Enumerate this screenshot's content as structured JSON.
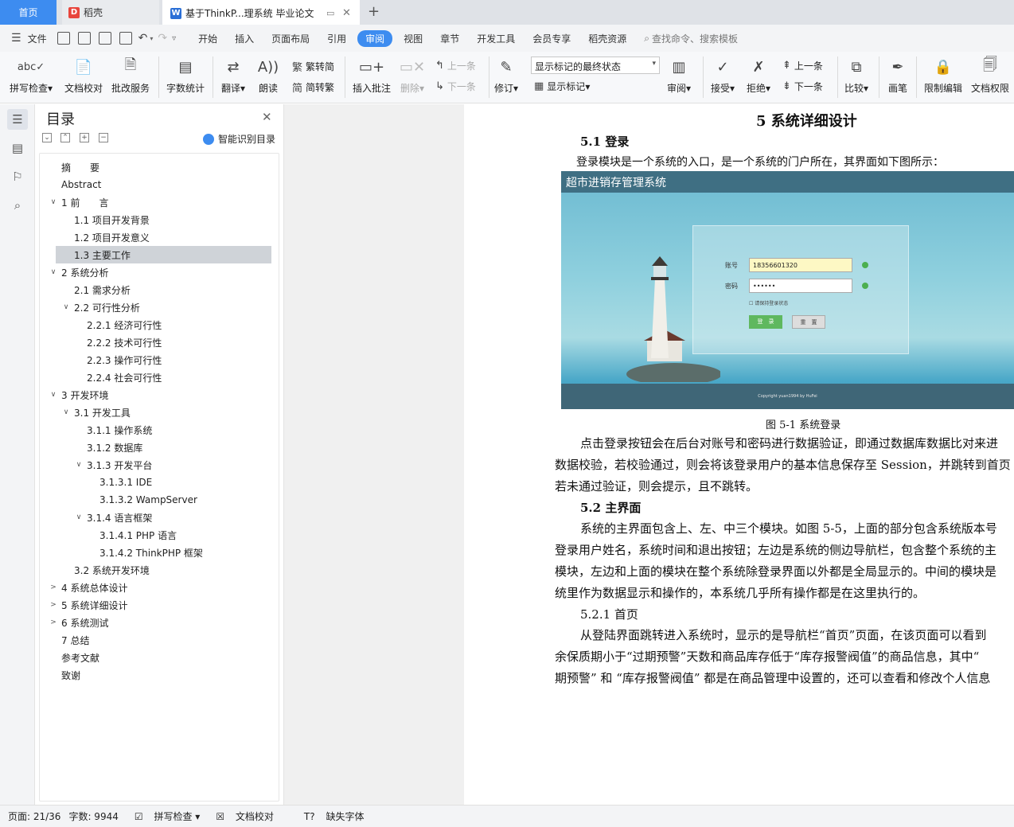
{
  "tabs": {
    "home": "首页",
    "daoke": "稻壳",
    "doc": "基于ThinkP...理系统 毕业论文"
  },
  "menu": {
    "file": "文件",
    "items": [
      "开始",
      "插入",
      "页面布局",
      "引用",
      "审阅",
      "视图",
      "章节",
      "开发工具",
      "会员专享",
      "稻壳资源"
    ],
    "active": "审阅",
    "search_placeholder": "查找命令、搜索模板"
  },
  "ribbon": {
    "spell_check": "拼写检查",
    "doc_proof": "文档校对",
    "batch_service": "批改服务",
    "word_count": "字数统计",
    "translate": "翻译",
    "read_aloud": "朗读",
    "trad_conv": "繁转简",
    "simp_conv": "简转繁",
    "insert_comment": "插入批注",
    "delete": "删除",
    "prev": "上一条",
    "next": "下一条",
    "track": "修订",
    "markup_state": "显示标记的最终状态",
    "show_markup": "显示标记",
    "review": "审阅",
    "accept": "接受",
    "reject": "拒绝",
    "prev2": "上一条",
    "next2": "下一条",
    "compare": "比较",
    "ink": "画笔",
    "restrict_edit": "限制编辑",
    "doc_rights": "文档权限"
  },
  "toc": {
    "title": "目录",
    "smart": "智能识别目录",
    "items": [
      {
        "label": "摘　　要",
        "level": 0,
        "tw": ""
      },
      {
        "label": "Abstract",
        "level": 0,
        "tw": ""
      },
      {
        "label": "1 前　　言",
        "level": 0,
        "tw": "v"
      },
      {
        "label": "1.1  项目开发背景",
        "level": 1,
        "tw": ""
      },
      {
        "label": "1.2  项目开发意义",
        "level": 1,
        "tw": ""
      },
      {
        "label": "1.3  主要工作",
        "level": 1,
        "tw": "",
        "selected": true
      },
      {
        "label": "2  系统分析",
        "level": 0,
        "tw": "v"
      },
      {
        "label": "2.1  需求分析",
        "level": 1,
        "tw": ""
      },
      {
        "label": "2.2  可行性分析",
        "level": 1,
        "tw": "v"
      },
      {
        "label": "2.2.1  经济可行性",
        "level": 2,
        "tw": ""
      },
      {
        "label": "2.2.2  技术可行性",
        "level": 2,
        "tw": ""
      },
      {
        "label": "2.2.3  操作可行性",
        "level": 2,
        "tw": ""
      },
      {
        "label": "2.2.4  社会可行性",
        "level": 2,
        "tw": ""
      },
      {
        "label": "3  开发环境",
        "level": 0,
        "tw": "v"
      },
      {
        "label": "3.1  开发工具",
        "level": 1,
        "tw": "v"
      },
      {
        "label": "3.1.1  操作系统",
        "level": 2,
        "tw": ""
      },
      {
        "label": "3.1.2  数据库",
        "level": 2,
        "tw": ""
      },
      {
        "label": "3.1.3  开发平台",
        "level": 2,
        "tw": "v"
      },
      {
        "label": "3.1.3.1 IDE",
        "level": 3,
        "tw": ""
      },
      {
        "label": "3.1.3.2 WampServer",
        "level": 3,
        "tw": ""
      },
      {
        "label": "3.1.4  语言框架",
        "level": 2,
        "tw": "v"
      },
      {
        "label": "3.1.4.1 PHP 语言",
        "level": 3,
        "tw": ""
      },
      {
        "label": "3.1.4.2 ThinkPHP 框架",
        "level": 3,
        "tw": ""
      },
      {
        "label": "3.2  系统开发环境",
        "level": 1,
        "tw": ""
      },
      {
        "label": "4  系统总体设计",
        "level": 0,
        "tw": ">"
      },
      {
        "label": "5  系统详细设计",
        "level": 0,
        "tw": ">"
      },
      {
        "label": "6  系统测试",
        "level": 0,
        "tw": ">"
      },
      {
        "label": "7  总结",
        "level": 0,
        "tw": ""
      },
      {
        "label": "参考文献",
        "level": 0,
        "tw": ""
      },
      {
        "label": "致谢",
        "level": 0,
        "tw": ""
      }
    ]
  },
  "doc": {
    "chapter": "5  系统详细设计",
    "s51": "5.1  登录",
    "p1": "登录模块是一个系统的入口，是一个系统的门户所在，其界面如下图所示：",
    "fig_title_bar": "超市进销存管理系统",
    "fig_account_label": "账号",
    "fig_account_value": "18356601320",
    "fig_pwd_label": "密码",
    "fig_pwd_value": "••••••",
    "fig_remember": "请保持登录状态",
    "fig_login_btn": "登　录",
    "fig_reset_btn": "重　置",
    "fig_footer": "Copyright yuan1994 by HuFei",
    "caption": "图 5-1  系统登录",
    "p2a": "点击登录按钮会在后台对账号和密码进行数据验证，即通过数据库数据比对来进",
    "p2b": "数据校验，若校验通过，则会将该登录用户的基本信息保存至 Session，并跳转到首页",
    "p2c": "若未通过验证，则会提示，且不跳转。",
    "s52": "5.2  主界面",
    "p3a": "系统的主界面包含上、左、中三个模块。如图 5-5，上面的部分包含系统版本号",
    "p3b": "登录用户姓名，系统时间和退出按钮；左边是系统的侧边导航栏，包含整个系统的主",
    "p3c": "模块，左边和上面的模块在整个系统除登录界面以外都是全局显示的。中间的模块是",
    "p3d": "统里作为数据显示和操作的，本系统几乎所有操作都是在这里执行的。",
    "s521": "5.2.1  首页",
    "p4a": "从登陆界面跳转进入系统时，显示的是导航栏“首页”页面，在该页面可以看到",
    "p4b": "余保质期小于“过期预警”天数和商品库存低于“库存报警阀值”的商品信息，其中“",
    "p4c": "期预警” 和 “库存报警阀值” 都是在商品管理中设置的，还可以查看和修改个人信息"
  },
  "status": {
    "page": "页面: 21/36",
    "words": "字数: 9944",
    "spell": "拼写检查",
    "proof": "文档校对",
    "missing_font": "缺失字体"
  },
  "colors": {
    "accent": "#3d8cf0",
    "toc_selected": "#cfd3d8"
  }
}
